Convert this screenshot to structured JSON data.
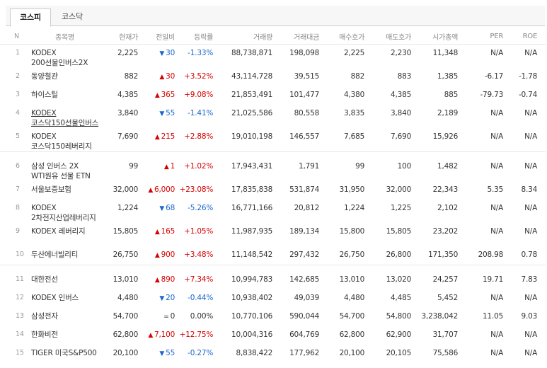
{
  "tabs": [
    "코스피",
    "코스닥"
  ],
  "columns": [
    "N",
    "종목명",
    "현재가",
    "전일비",
    "등락률",
    "거래량",
    "거래대금",
    "매수호가",
    "매도호가",
    "시가총액",
    "PER",
    "ROE"
  ],
  "groups": [
    [
      {
        "n": "1",
        "name": "KODEX 200선물인버스2X",
        "price": "2,225",
        "dir": "down",
        "change": "30",
        "rate": "-1.33%",
        "volume": "88,738,871",
        "amount": "198,098",
        "bid": "2,225",
        "ask": "2,230",
        "cap": "11,348",
        "per": "N/A",
        "roe": "N/A"
      },
      {
        "n": "2",
        "name": "동양철관",
        "price": "882",
        "dir": "up",
        "change": "30",
        "rate": "+3.52%",
        "volume": "43,114,728",
        "amount": "39,515",
        "bid": "882",
        "ask": "883",
        "cap": "1,385",
        "per": "-6.17",
        "roe": "-1.78"
      },
      {
        "n": "3",
        "name": "하이스틸",
        "price": "4,385",
        "dir": "up",
        "change": "365",
        "rate": "+9.08%",
        "volume": "21,853,491",
        "amount": "101,477",
        "bid": "4,380",
        "ask": "4,385",
        "cap": "885",
        "per": "-79.73",
        "roe": "-0.74"
      },
      {
        "n": "4",
        "name": "KODEX 코스닥150선물인버스",
        "price": "3,840",
        "dir": "down",
        "change": "55",
        "rate": "-1.41%",
        "volume": "21,025,586",
        "amount": "80,558",
        "bid": "3,835",
        "ask": "3,840",
        "cap": "2,189",
        "per": "N/A",
        "roe": "N/A",
        "link": true
      },
      {
        "n": "5",
        "name": "KODEX 코스닥150레버리지",
        "price": "7,690",
        "dir": "up",
        "change": "215",
        "rate": "+2.88%",
        "volume": "19,010,198",
        "amount": "146,557",
        "bid": "7,685",
        "ask": "7,690",
        "cap": "15,926",
        "per": "N/A",
        "roe": "N/A"
      }
    ],
    [
      {
        "n": "6",
        "name": "삼성 인버스 2X WTI원유 선물 ETN",
        "price": "99",
        "dir": "up",
        "change": "1",
        "rate": "+1.02%",
        "volume": "17,943,431",
        "amount": "1,791",
        "bid": "99",
        "ask": "100",
        "cap": "1,482",
        "per": "N/A",
        "roe": "N/A"
      },
      {
        "n": "7",
        "name": "서울보증보험",
        "price": "32,000",
        "dir": "up",
        "change": "6,000",
        "rate": "+23.08%",
        "volume": "17,835,838",
        "amount": "531,874",
        "bid": "31,950",
        "ask": "32,000",
        "cap": "22,343",
        "per": "5.35",
        "roe": "8.34"
      },
      {
        "n": "8",
        "name": "KODEX 2차전지산업레버리지",
        "price": "1,224",
        "dir": "down",
        "change": "68",
        "rate": "-5.26%",
        "volume": "16,771,166",
        "amount": "20,812",
        "bid": "1,224",
        "ask": "1,225",
        "cap": "2,102",
        "per": "N/A",
        "roe": "N/A"
      },
      {
        "n": "9",
        "name": "KODEX 레버리지",
        "price": "15,805",
        "dir": "up",
        "change": "165",
        "rate": "+1.05%",
        "volume": "11,987,935",
        "amount": "189,134",
        "bid": "15,800",
        "ask": "15,805",
        "cap": "23,202",
        "per": "N/A",
        "roe": "N/A"
      },
      {
        "n": "10",
        "name": "두산에너빌리티",
        "price": "26,750",
        "dir": "up",
        "change": "900",
        "rate": "+3.48%",
        "volume": "11,148,542",
        "amount": "297,432",
        "bid": "26,750",
        "ask": "26,800",
        "cap": "171,350",
        "per": "208.98",
        "roe": "0.78"
      }
    ],
    [
      {
        "n": "11",
        "name": "대한전선",
        "price": "13,010",
        "dir": "up",
        "change": "890",
        "rate": "+7.34%",
        "volume": "10,994,783",
        "amount": "142,685",
        "bid": "13,010",
        "ask": "13,020",
        "cap": "24,257",
        "per": "19.71",
        "roe": "7.83"
      },
      {
        "n": "12",
        "name": "KODEX 인버스",
        "price": "4,480",
        "dir": "down",
        "change": "20",
        "rate": "-0.44%",
        "volume": "10,938,402",
        "amount": "49,039",
        "bid": "4,480",
        "ask": "4,485",
        "cap": "5,452",
        "per": "N/A",
        "roe": "N/A"
      },
      {
        "n": "13",
        "name": "삼성전자",
        "price": "54,700",
        "dir": "flat",
        "change": "0",
        "rate": "0.00%",
        "volume": "10,770,106",
        "amount": "590,044",
        "bid": "54,700",
        "ask": "54,800",
        "cap": "3,238,042",
        "per": "11.05",
        "roe": "9.03"
      },
      {
        "n": "14",
        "name": "한화비전",
        "price": "62,800",
        "dir": "up",
        "change": "7,100",
        "rate": "+12.75%",
        "volume": "10,004,316",
        "amount": "604,769",
        "bid": "62,800",
        "ask": "62,900",
        "cap": "31,707",
        "per": "N/A",
        "roe": "N/A"
      },
      {
        "n": "15",
        "name": "TIGER 미국S&P500",
        "price": "20,100",
        "dir": "down",
        "change": "55",
        "rate": "-0.27%",
        "volume": "8,838,422",
        "amount": "177,962",
        "bid": "20,100",
        "ask": "20,105",
        "cap": "75,586",
        "per": "N/A",
        "roe": "N/A"
      }
    ]
  ],
  "arrows": {
    "up": "▲",
    "down": "▼",
    "flat": "="
  }
}
